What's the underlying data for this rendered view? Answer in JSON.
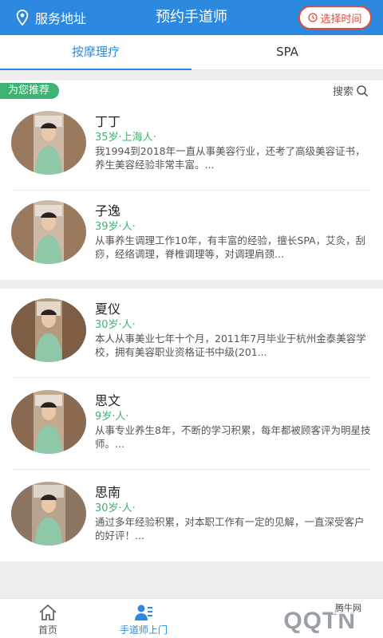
{
  "header": {
    "location_label": "服务地址",
    "title": "预约手道师",
    "time_button_label": "选择时间",
    "accent": "#2d88e0"
  },
  "tabs": [
    {
      "label": "按摩理疗",
      "active": true
    },
    {
      "label": "SPA",
      "active": false
    }
  ],
  "section": {
    "badge": "为您推荐",
    "search_label": "搜索"
  },
  "therapists": [
    {
      "name": "丁丁",
      "meta": "35岁·上海人·",
      "desc": "我1994到2018年一直从事美容行业，还考了高级美容证书，养生美容经验非常丰富。..."
    },
    {
      "name": "子逸",
      "meta": "39岁·人·",
      "desc": "从事养生调理工作10年，有丰富的经验，擅长SPA，艾灸，刮痧，经络调理，脊椎调理等，对调理肩颈..."
    },
    {
      "name": "夏仪",
      "meta": "30岁·人·",
      "desc": "本人从事美业七年十个月，2011年7月毕业于杭州金泰美容学校，拥有美容职业资格证书中级(201..."
    },
    {
      "name": "思文",
      "meta": "9岁·人·",
      "desc": "从事专业养生8年，不断的学习积累，每年都被顾客评为明星技师。..."
    },
    {
      "name": "思南",
      "meta": "30岁·人·",
      "desc": "通过多年经验积累，对本职工作有一定的见解，一直深受客户的好评！..."
    }
  ],
  "bottom_nav": [
    {
      "label": "首页",
      "icon": "home-icon",
      "active": false
    },
    {
      "label": "手道师上门",
      "icon": "therapist-icon",
      "active": true
    }
  ],
  "watermark": {
    "main": "QQTN",
    "sub": "腾牛网"
  }
}
